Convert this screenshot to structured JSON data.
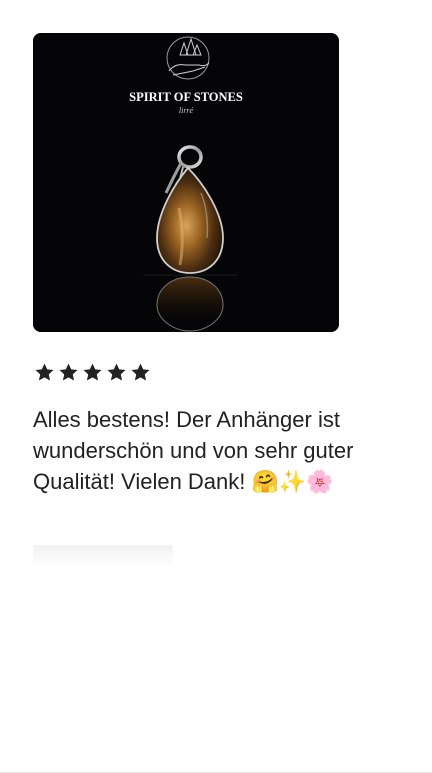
{
  "review": {
    "photo": {
      "brand_name": "SPIRIT OF STONES",
      "brand_sub": "lirré",
      "logo_icon": "hand-with-crystals-icon"
    },
    "rating": {
      "value": 5,
      "max": 5,
      "icon": "star-icon",
      "color": "#222222"
    },
    "text": "Alles bestens! Der Anhänger ist wunderschön und von sehr guter Qualität! Vielen Dank! 🤗✨🌸"
  }
}
